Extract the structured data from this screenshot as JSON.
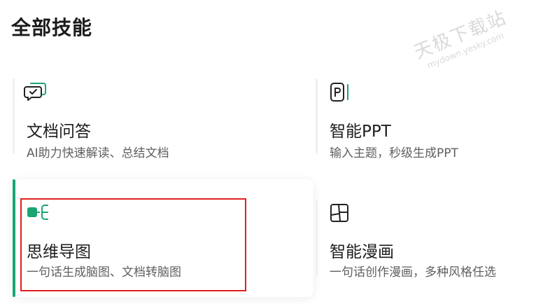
{
  "page": {
    "title": "全部技能"
  },
  "watermark": {
    "main": "天极下载站",
    "url": "mydown.yesky.com"
  },
  "colors": {
    "accent": "#1aa572",
    "highlight_box": "#e0201f"
  },
  "skills": [
    {
      "name": "文档问答",
      "desc": "AI助力快速解读、总结文档",
      "icon": "chat-doc-icon"
    },
    {
      "name": "智能PPT",
      "desc": "输入主题，秒级生成PPT",
      "icon": "ppt-icon"
    },
    {
      "name": "思维导图",
      "desc": "一句话生成脑图、文档转脑图",
      "icon": "mind-map-icon",
      "selected": true
    },
    {
      "name": "智能漫画",
      "desc": "一句话创作漫画，多种风格任选",
      "icon": "comic-icon"
    }
  ]
}
